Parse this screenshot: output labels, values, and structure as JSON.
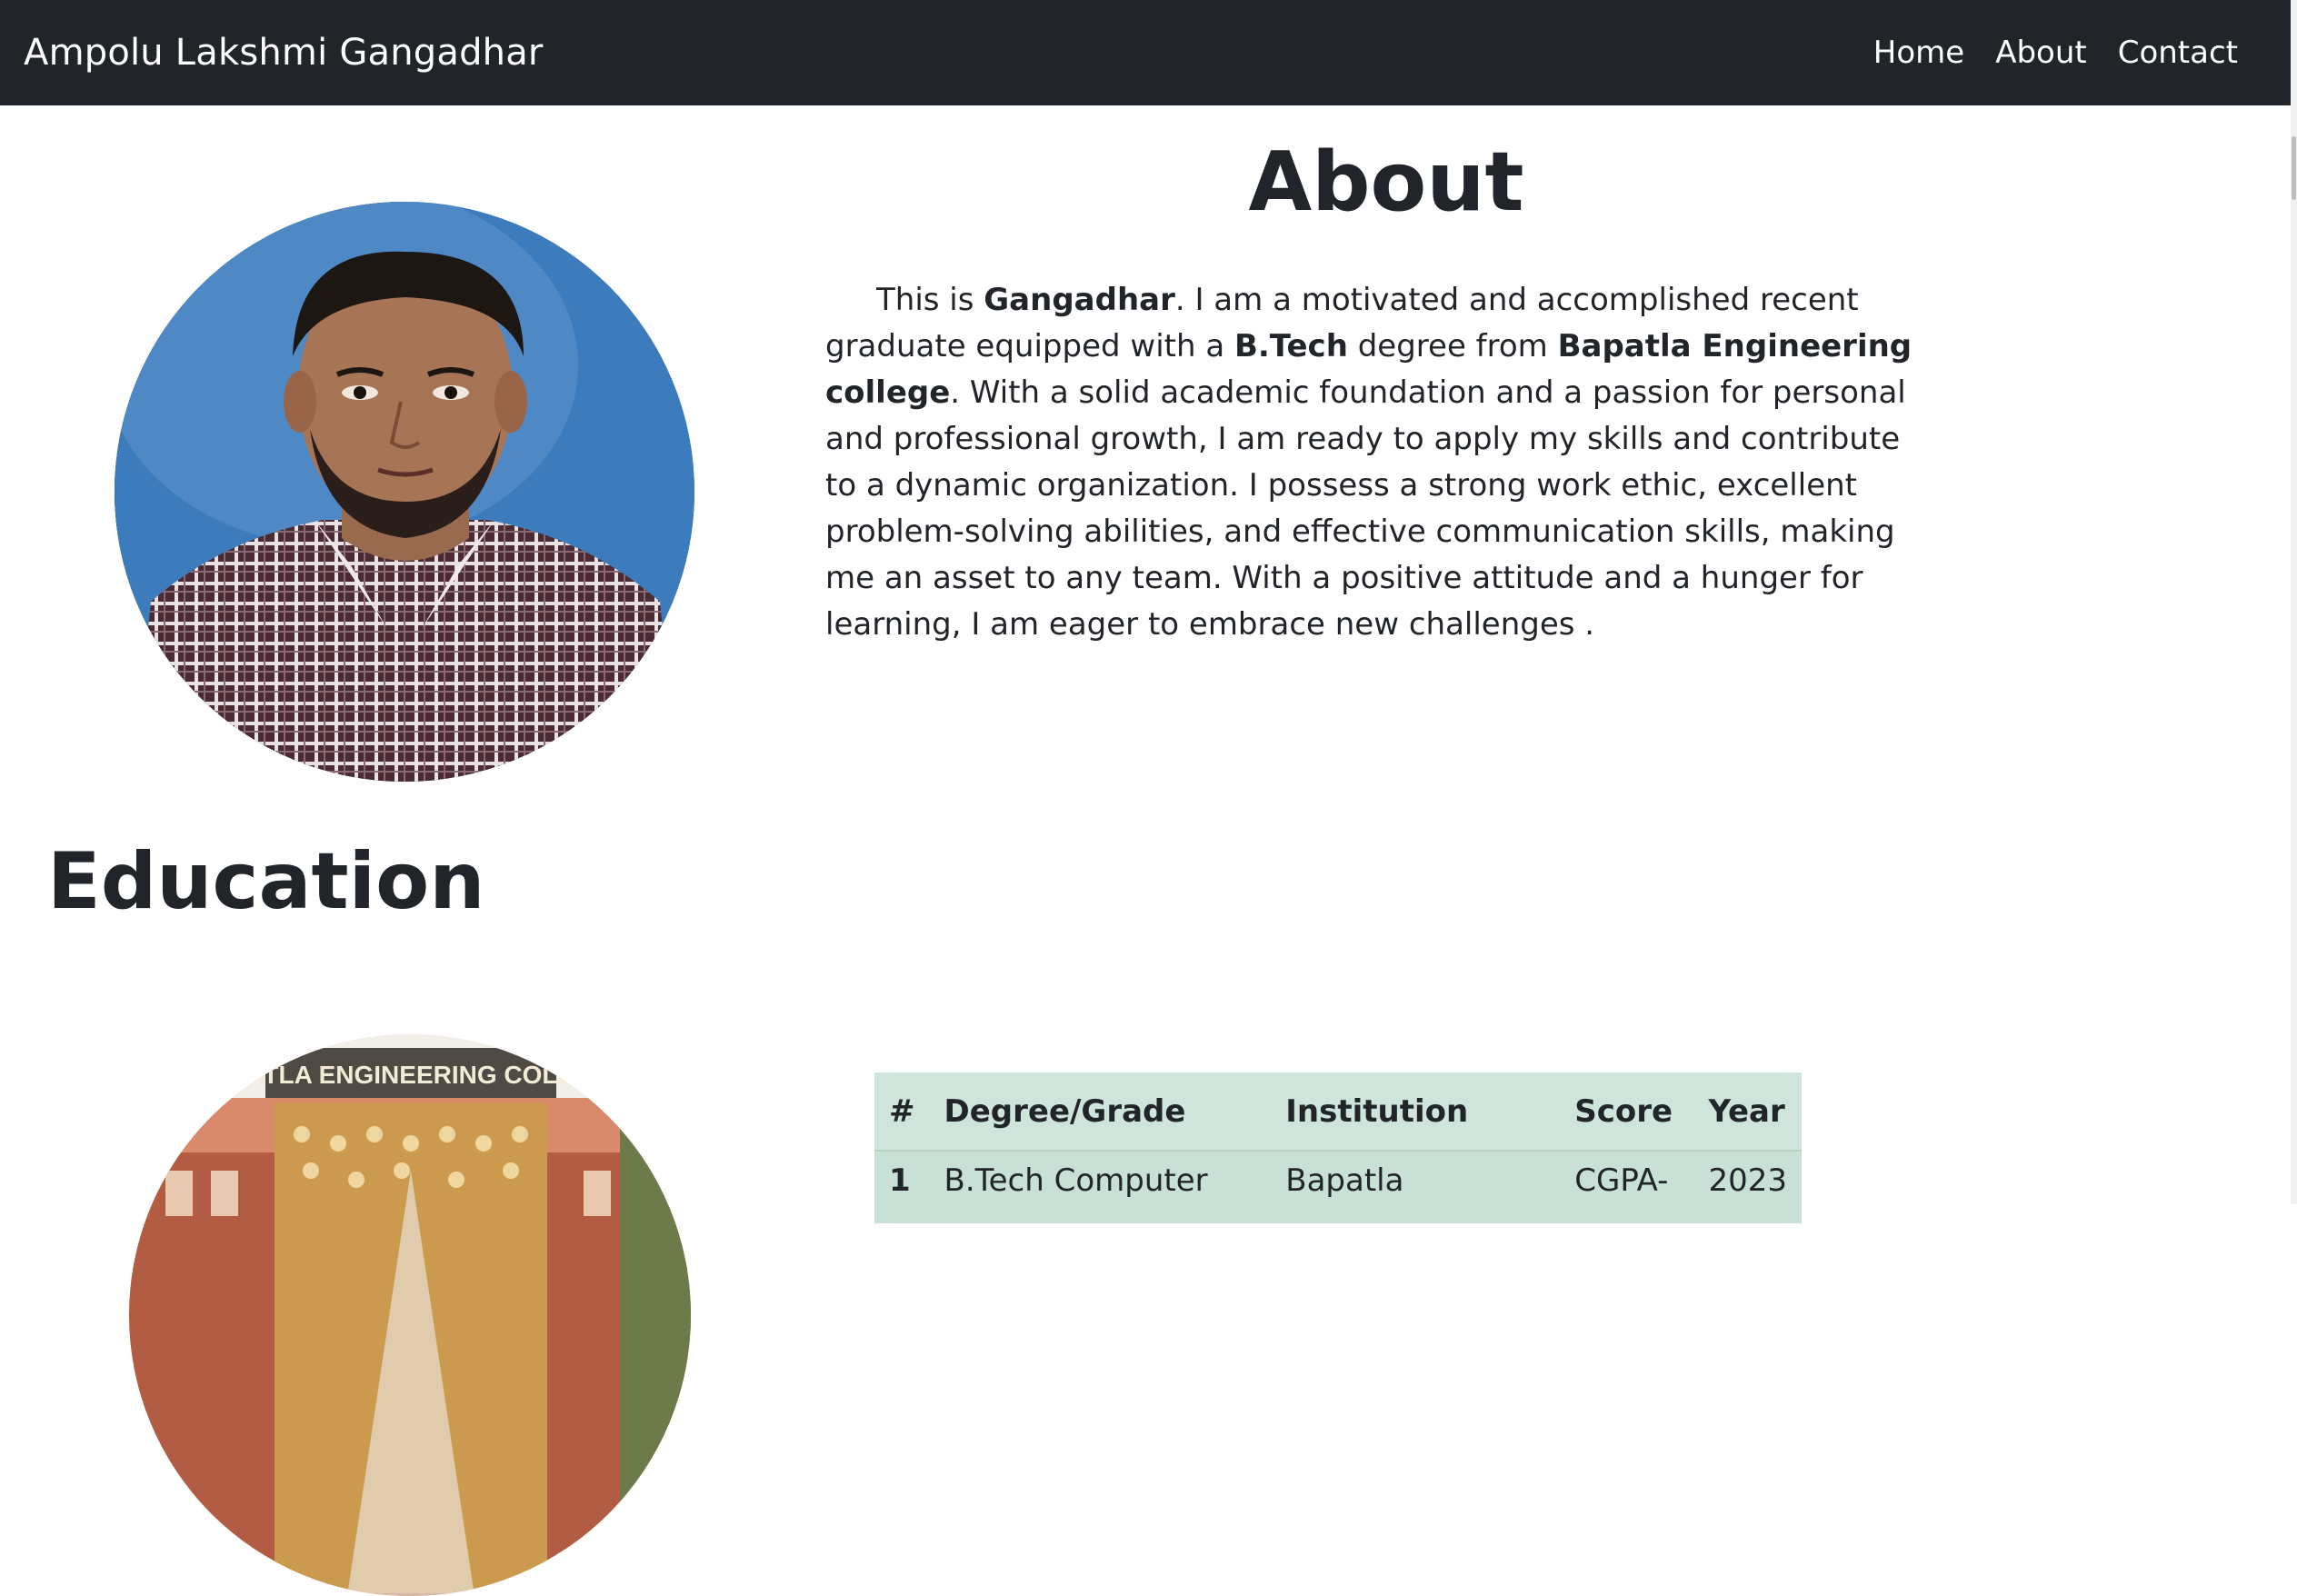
{
  "navbar": {
    "brand": "Ampolu Lakshmi Gangadhar",
    "links": [
      "Home",
      "About",
      "Contact"
    ]
  },
  "about": {
    "title": "About",
    "p_intro": "This is ",
    "p_name": "Gangadhar",
    "p_1": ". I am a motivated and accomplished recent graduate equipped with a ",
    "p_degree": "B.Tech",
    "p_2": " degree from ",
    "p_college": "Bapatla Engineering college",
    "p_3": ". With a solid academic foundation and a passion for personal and professional growth, I am ready to apply my skills and contribute to a dynamic organization. I possess a strong work ethic, excellent problem-solving abilities, and effective communication skills, making me an asset to any team. With a positive attitude and a hunger for learning, I am eager to embrace new challenges ."
  },
  "education": {
    "title": "Education",
    "college_sign": "BAPATLA ENGINEERING COLLEGE",
    "table": {
      "headers": [
        "#",
        "Degree/Grade",
        "Institution",
        "Score",
        "Year"
      ],
      "rows": [
        [
          "1",
          "B.Tech Computer",
          "Bapatla",
          "CGPA-",
          "2023"
        ]
      ]
    }
  },
  "colors": {
    "navbar_bg": "#212529",
    "table_header_bg": "#cfe5db",
    "table_row_bg": "#c8e0d5"
  },
  "icons": {
    "profile_photo": "person-photo",
    "college_photo": "building-photo"
  }
}
